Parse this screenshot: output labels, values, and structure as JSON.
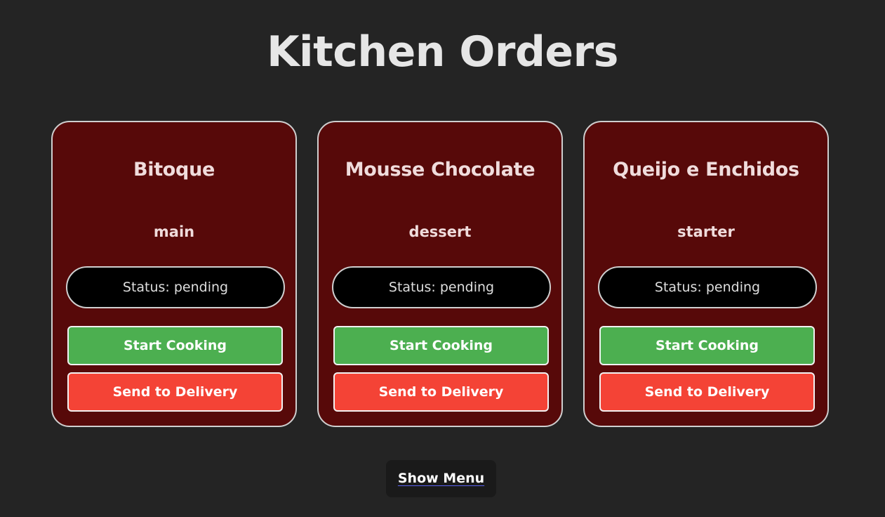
{
  "page": {
    "title": "Kitchen Orders"
  },
  "orders": [
    {
      "name": "Bitoque",
      "category": "main",
      "status": "Status: pending",
      "start_label": "Start Cooking",
      "deliver_label": "Send to Delivery"
    },
    {
      "name": "Mousse Chocolate",
      "category": "dessert",
      "status": "Status: pending",
      "start_label": "Start Cooking",
      "deliver_label": "Send to Delivery"
    },
    {
      "name": "Queijo e Enchidos",
      "category": "starter",
      "status": "Status: pending",
      "start_label": "Start Cooking",
      "deliver_label": "Send to Delivery"
    }
  ],
  "footer": {
    "show_menu_label": "Show Menu"
  },
  "colors": {
    "background": "#242424",
    "card": "#570909",
    "start": "#4caf50",
    "deliver": "#f44336"
  }
}
